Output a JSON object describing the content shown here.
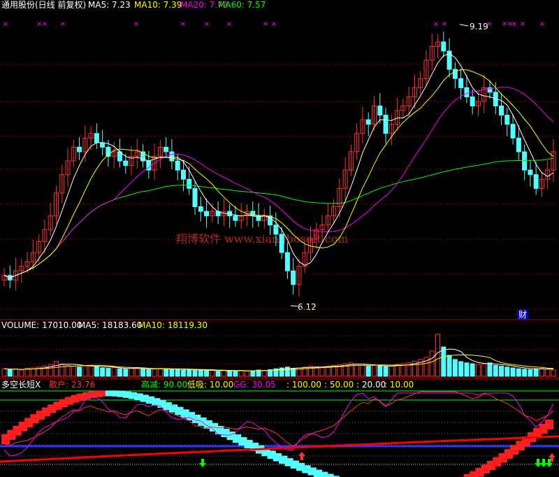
{
  "header": {
    "title": "通用股份(日线 前复权)",
    "ma5": "MA5: 7.23",
    "ma10": "MA10: 7.39",
    "ma20": "MA20: 7.72",
    "ma60": "MA60: 7.57"
  },
  "annotations": {
    "high": "9.19",
    "low": "6.12",
    "watermark": "翔博软件 www.xiangbosoft.com",
    "cai": "财"
  },
  "volume": {
    "label": "VOLUME: 17010.00",
    "ma5": "MA5: 18183.60",
    "ma10": "MA10: 18119.30"
  },
  "indicator": {
    "name": "多空长短X",
    "sanhu": "散户: 23.76",
    "gaojian": "高减: 90.00",
    "dixi": "低吸: 10.00",
    "gg": "GG: 30.05",
    "l100": ": 100.00",
    "l50": ": 50.00",
    "l20": ": 20.00",
    "l10": ": 10.00"
  },
  "colors": {
    "up": "#ff3232",
    "down": "#54ffff",
    "ma5": "#ffffff",
    "ma10": "#ffff00",
    "ma20": "#ff00ff",
    "ma60": "#00ff00",
    "grid": "#8b0000",
    "panel_border": "#b40000"
  },
  "chart_data": {
    "type": "candlestick",
    "price_range": [
      6.12,
      9.19
    ],
    "closes": [
      6.45,
      6.4,
      6.5,
      6.55,
      6.6,
      6.7,
      6.82,
      6.95,
      7.1,
      7.35,
      7.55,
      7.7,
      7.85,
      7.8,
      7.95,
      8.0,
      7.9,
      7.85,
      7.75,
      7.8,
      7.7,
      7.65,
      7.75,
      7.8,
      7.7,
      7.6,
      7.75,
      7.85,
      7.8,
      7.7,
      7.6,
      7.5,
      7.4,
      7.2,
      7.15,
      7.1,
      7.15,
      7.1,
      7.15,
      7.1,
      7.05,
      7.1,
      7.15,
      7.1,
      7.05,
      7.1,
      7.0,
      6.9,
      6.7,
      6.5,
      6.35,
      6.55,
      6.7,
      6.85,
      6.95,
      7.0,
      7.1,
      7.2,
      7.4,
      7.6,
      7.8,
      8.0,
      8.15,
      8.1,
      8.3,
      8.2,
      8.0,
      8.1,
      8.25,
      8.3,
      8.4,
      8.5,
      8.6,
      8.8,
      8.95,
      9.0,
      8.9,
      8.7,
      8.6,
      8.5,
      8.4,
      8.3,
      8.35,
      8.5,
      8.45,
      8.3,
      8.2,
      8.1,
      7.95,
      7.8,
      7.6,
      7.55,
      7.4,
      7.5,
      7.6,
      7.8
    ],
    "volume": [
      1.8,
      1.6,
      1.7,
      1.5,
      1.9,
      2.0,
      2.2,
      2.4,
      2.8,
      3.5,
      3.0,
      2.6,
      2.4,
      2.2,
      2.5,
      2.6,
      2.3,
      2.0,
      1.9,
      2.1,
      1.8,
      1.7,
      1.9,
      2.0,
      1.8,
      1.6,
      1.7,
      1.9,
      1.8,
      1.7,
      1.6,
      1.5,
      1.6,
      1.4,
      1.5,
      1.3,
      1.4,
      1.2,
      1.4,
      1.3,
      1.3,
      1.4,
      1.2,
      1.3,
      1.5,
      1.4,
      1.6,
      1.8,
      2.0,
      2.2,
      1.9,
      2.0,
      2.2,
      2.4,
      2.3,
      2.2,
      2.4,
      2.6,
      2.8,
      3.0,
      3.2,
      2.9,
      2.6,
      2.4,
      2.6,
      2.5,
      2.3,
      2.4,
      2.8,
      3.0,
      3.2,
      3.6,
      4.0,
      4.5,
      6.0,
      10.0,
      7.0,
      5.0,
      4.0,
      3.5,
      3.2,
      3.0,
      2.8,
      2.9,
      3.2,
      2.6,
      2.4,
      2.2,
      2.0,
      1.8,
      1.7,
      1.6,
      1.8,
      1.9,
      1.7,
      1.5
    ],
    "indicator_levels": [
      100,
      50,
      20,
      10,
      90,
      10
    ]
  }
}
